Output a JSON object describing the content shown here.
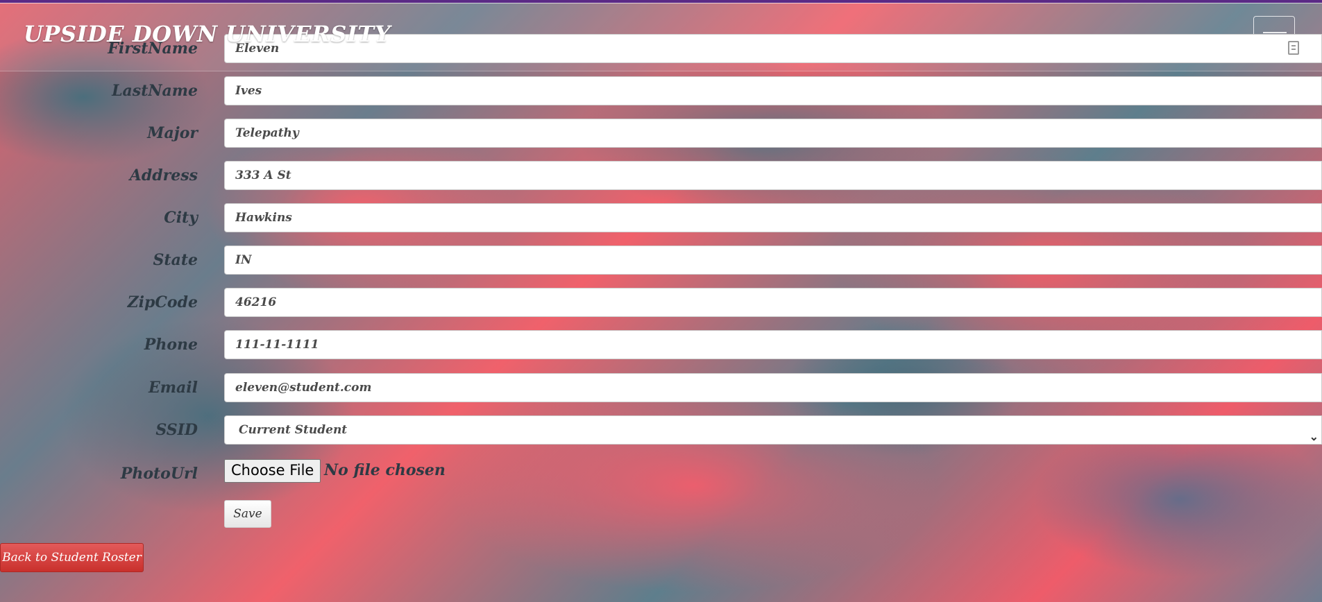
{
  "navbar": {
    "brand": "UPSIDE DOWN UNIVERSITY"
  },
  "form": {
    "fields": [
      {
        "label": "FirstName",
        "value": "Eleven"
      },
      {
        "label": "LastName",
        "value": "Ives"
      },
      {
        "label": "Major",
        "value": "Telepathy"
      },
      {
        "label": "Address",
        "value": "333 A St"
      },
      {
        "label": "City",
        "value": "Hawkins"
      },
      {
        "label": "State",
        "value": "IN"
      },
      {
        "label": "ZipCode",
        "value": "46216"
      },
      {
        "label": "Phone",
        "value": "111-11-1111"
      },
      {
        "label": "Email",
        "value": "eleven@student.com"
      }
    ],
    "ssid": {
      "label": "SSID",
      "selected": "Current Student"
    },
    "photo": {
      "label": "PhotoUrl",
      "button": "Choose File",
      "status": "No file chosen"
    },
    "save_label": "Save"
  },
  "back_button": "Back to Student Roster",
  "icons": {
    "autofill": "contact-card-icon",
    "menu": "hamburger-menu-icon",
    "dropdown": "chevron-down-icon"
  },
  "colors": {
    "top_stripe": "#5b2a86",
    "back_button": "#d9534f",
    "label_text": "#2d3a44"
  }
}
